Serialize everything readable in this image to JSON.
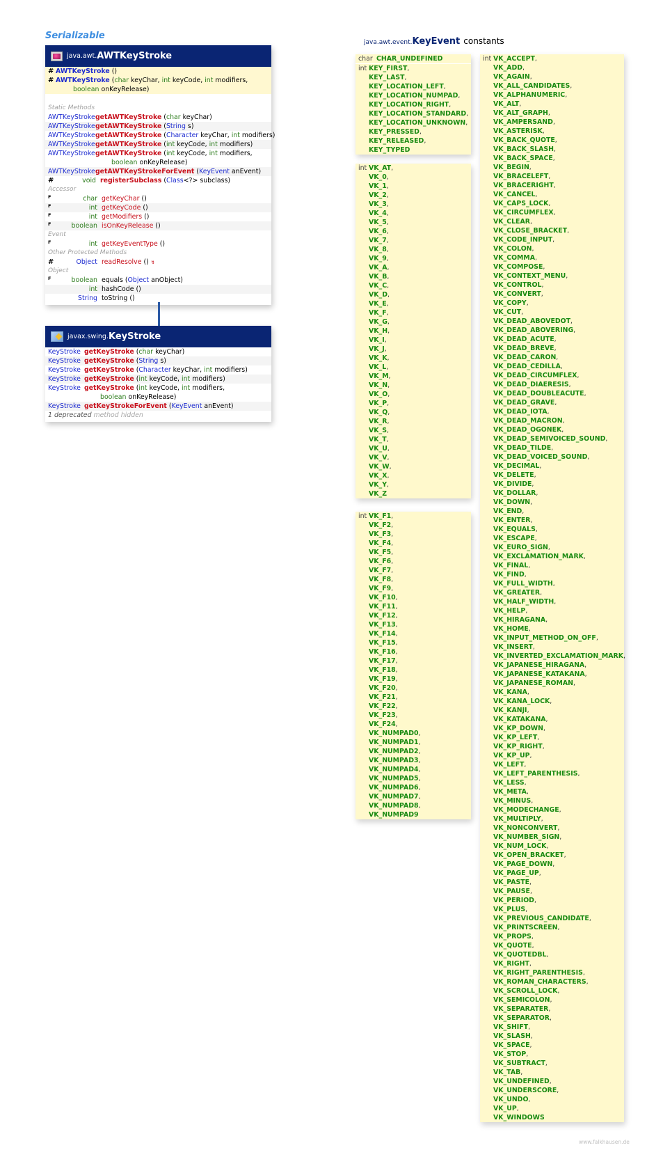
{
  "interface_label": "Serializable",
  "awt_card": {
    "package": "java.awt.",
    "class_name": "AWTKeyStroke",
    "constructors": [
      {
        "modifier": "#",
        "name": "AWTKeyStroke",
        "params": "()"
      },
      {
        "modifier": "#",
        "name": "AWTKeyStroke",
        "params_line1": "(char keyChar, int keyCode, int modifiers,",
        "params_line2": "boolean onKeyRelease)"
      }
    ],
    "sections": {
      "static": "Static Methods",
      "accessor": "Accessor",
      "event": "Event",
      "other_protected": "Other Protected Methods",
      "object": "Object"
    },
    "static_methods": [
      {
        "ret": "AWTKeyStroke",
        "name": "getAWTKeyStroke",
        "params": "(char keyChar)"
      },
      {
        "ret": "AWTKeyStroke",
        "name": "getAWTKeyStroke",
        "params": "(String s)"
      },
      {
        "ret": "AWTKeyStroke",
        "name": "getAWTKeyStroke",
        "params": "(Character keyChar, int modifiers)"
      },
      {
        "ret": "AWTKeyStroke",
        "name": "getAWTKeyStroke",
        "params": "(int keyCode, int modifiers)"
      },
      {
        "ret": "AWTKeyStroke",
        "name": "getAWTKeyStroke",
        "params": "(int keyCode, int modifiers,",
        "params_line2": "boolean onKeyRelease)"
      },
      {
        "ret": "AWTKeyStroke",
        "name": "getAWTKeyStrokeForEvent",
        "params": "(KeyEvent anEvent)"
      },
      {
        "modifier": "#",
        "ret": "void",
        "name": "registerSubclass",
        "params": "(Class<?> subclass)"
      }
    ],
    "accessor_methods": [
      {
        "modifier": "F",
        "ret": "char",
        "name": "getKeyChar",
        "params": "()"
      },
      {
        "modifier": "F",
        "ret": "int",
        "name": "getKeyCode",
        "params": "()"
      },
      {
        "modifier": "F",
        "ret": "int",
        "name": "getModifiers",
        "params": "()"
      },
      {
        "modifier": "F",
        "ret": "boolean",
        "name": "isOnKeyRelease",
        "params": "()"
      }
    ],
    "event_methods": [
      {
        "modifier": "F",
        "ret": "int",
        "name": "getKeyEventType",
        "params": "()"
      }
    ],
    "other_protected_methods": [
      {
        "modifier": "#",
        "ret": "Object",
        "name": "readResolve",
        "params": "()",
        "marker": "↯"
      }
    ],
    "object_methods": [
      {
        "modifier": "F",
        "ret": "boolean",
        "name": "equals",
        "params": "(Object anObject)"
      },
      {
        "ret": "int",
        "name": "hashCode",
        "params": "()"
      },
      {
        "ret": "String",
        "name": "toString",
        "params": "()"
      }
    ]
  },
  "swing_card": {
    "package": "javax.swing.",
    "class_name": "KeyStroke",
    "methods": [
      {
        "ret": "KeyStroke",
        "name": "getKeyStroke",
        "params": "(char keyChar)"
      },
      {
        "ret": "KeyStroke",
        "name": "getKeyStroke",
        "params": "(String s)"
      },
      {
        "ret": "KeyStroke",
        "name": "getKeyStroke",
        "params": "(Character keyChar, int modifiers)"
      },
      {
        "ret": "KeyStroke",
        "name": "getKeyStroke",
        "params": "(int keyCode, int modifiers)"
      },
      {
        "ret": "KeyStroke",
        "name": "getKeyStroke",
        "params": "(int keyCode, int modifiers,",
        "params_line2": "boolean onKeyRelease)"
      },
      {
        "ret": "KeyStroke",
        "name": "getKeyStrokeForEvent",
        "params": "(KeyEvent anEvent)"
      }
    ],
    "hidden_note_bold": "1 deprecated",
    "hidden_note_rest": "method hidden"
  },
  "keyevent": {
    "package": "java.awt.event.",
    "class_name": "KeyEvent",
    "label": "constants",
    "box1": [
      {
        "type": "char",
        "names": [
          "CHAR_UNDEFINED"
        ]
      },
      {
        "type": "int",
        "names": [
          "KEY_FIRST",
          "KEY_LAST",
          "KEY_LOCATION_LEFT",
          "KEY_LOCATION_NUMPAD",
          "KEY_LOCATION_RIGHT",
          "KEY_LOCATION_STANDARD",
          "KEY_LOCATION_UNKNOWN",
          "KEY_PRESSED",
          "KEY_RELEASED",
          "KEY_TYPED"
        ]
      }
    ],
    "box2": {
      "type": "int",
      "names": [
        "VK_AT",
        "VK_0",
        "VK_1",
        "VK_2",
        "VK_3",
        "VK_4",
        "VK_5",
        "VK_6",
        "VK_7",
        "VK_8",
        "VK_9",
        "VK_A",
        "VK_B",
        "VK_C",
        "VK_D",
        "VK_E",
        "VK_F",
        "VK_G",
        "VK_H",
        "VK_I",
        "VK_J",
        "VK_K",
        "VK_L",
        "VK_M",
        "VK_N",
        "VK_O",
        "VK_P",
        "VK_Q",
        "VK_R",
        "VK_S",
        "VK_T",
        "VK_U",
        "VK_V",
        "VK_W",
        "VK_X",
        "VK_Y",
        "VK_Z"
      ]
    },
    "box3": {
      "type": "int",
      "names": [
        "VK_F1",
        "VK_F2",
        "VK_F3",
        "VK_F4",
        "VK_F5",
        "VK_F6",
        "VK_F7",
        "VK_F8",
        "VK_F9",
        "VK_F10",
        "VK_F11",
        "VK_F12",
        "VK_F13",
        "VK_F14",
        "VK_F15",
        "VK_F16",
        "VK_F17",
        "VK_F18",
        "VK_F19",
        "VK_F20",
        "VK_F21",
        "VK_F22",
        "VK_F23",
        "VK_F24",
        "VK_NUMPAD0",
        "VK_NUMPAD1",
        "VK_NUMPAD2",
        "VK_NUMPAD3",
        "VK_NUMPAD4",
        "VK_NUMPAD5",
        "VK_NUMPAD6",
        "VK_NUMPAD7",
        "VK_NUMPAD8",
        "VK_NUMPAD9"
      ]
    },
    "box4": {
      "type": "int",
      "names": [
        "VK_ACCEPT",
        "VK_ADD",
        "VK_AGAIN",
        "VK_ALL_CANDIDATES",
        "VK_ALPHANUMERIC",
        "VK_ALT",
        "VK_ALT_GRAPH",
        "VK_AMPERSAND",
        "VK_ASTERISK",
        "VK_BACK_QUOTE",
        "VK_BACK_SLASH",
        "VK_BACK_SPACE",
        "VK_BEGIN",
        "VK_BRACELEFT",
        "VK_BRACERIGHT",
        "VK_CANCEL",
        "VK_CAPS_LOCK",
        "VK_CIRCUMFLEX",
        "VK_CLEAR",
        "VK_CLOSE_BRACKET",
        "VK_CODE_INPUT",
        "VK_COLON",
        "VK_COMMA",
        "VK_COMPOSE",
        "VK_CONTEXT_MENU",
        "VK_CONTROL",
        "VK_CONVERT",
        "VK_COPY",
        "VK_CUT",
        "VK_DEAD_ABOVEDOT",
        "VK_DEAD_ABOVERING",
        "VK_DEAD_ACUTE",
        "VK_DEAD_BREVE",
        "VK_DEAD_CARON",
        "VK_DEAD_CEDILLA",
        "VK_DEAD_CIRCUMFLEX",
        "VK_DEAD_DIAERESIS",
        "VK_DEAD_DOUBLEACUTE",
        "VK_DEAD_GRAVE",
        "VK_DEAD_IOTA",
        "VK_DEAD_MACRON",
        "VK_DEAD_OGONEK",
        "VK_DEAD_SEMIVOICED_SOUND",
        "VK_DEAD_TILDE",
        "VK_DEAD_VOICED_SOUND",
        "VK_DECIMAL",
        "VK_DELETE",
        "VK_DIVIDE",
        "VK_DOLLAR",
        "VK_DOWN",
        "VK_END",
        "VK_ENTER",
        "VK_EQUALS",
        "VK_ESCAPE",
        "VK_EURO_SIGN",
        "VK_EXCLAMATION_MARK",
        "VK_FINAL",
        "VK_FIND",
        "VK_FULL_WIDTH",
        "VK_GREATER",
        "VK_HALF_WIDTH",
        "VK_HELP",
        "VK_HIRAGANA",
        "VK_HOME",
        "VK_INPUT_METHOD_ON_OFF",
        "VK_INSERT",
        "VK_INVERTED_EXCLAMATION_MARK",
        "VK_JAPANESE_HIRAGANA",
        "VK_JAPANESE_KATAKANA",
        "VK_JAPANESE_ROMAN",
        "VK_KANA",
        "VK_KANA_LOCK",
        "VK_KANJI",
        "VK_KATAKANA",
        "VK_KP_DOWN",
        "VK_KP_LEFT",
        "VK_KP_RIGHT",
        "VK_KP_UP",
        "VK_LEFT",
        "VK_LEFT_PARENTHESIS",
        "VK_LESS",
        "VK_META",
        "VK_MINUS",
        "VK_MODECHANGE",
        "VK_MULTIPLY",
        "VK_NONCONVERT",
        "VK_NUMBER_SIGN",
        "VK_NUM_LOCK",
        "VK_OPEN_BRACKET",
        "VK_PAGE_DOWN",
        "VK_PAGE_UP",
        "VK_PASTE",
        "VK_PAUSE",
        "VK_PERIOD",
        "VK_PLUS",
        "VK_PREVIOUS_CANDIDATE",
        "VK_PRINTSCREEN",
        "VK_PROPS",
        "VK_QUOTE",
        "VK_QUOTEDBL",
        "VK_RIGHT",
        "VK_RIGHT_PARENTHESIS",
        "VK_ROMAN_CHARACTERS",
        "VK_SCROLL_LOCK",
        "VK_SEMICOLON",
        "VK_SEPARATER",
        "VK_SEPARATOR",
        "VK_SHIFT",
        "VK_SLASH",
        "VK_SPACE",
        "VK_STOP",
        "VK_SUBTRACT",
        "VK_TAB",
        "VK_UNDEFINED",
        "VK_UNDERSCORE",
        "VK_UNDO",
        "VK_UP",
        "VK_WINDOWS"
      ]
    }
  },
  "footer": "www.falkhausen.de",
  "colors": {
    "header_bg": "#0a2573",
    "type_blue": "#1d2bd0",
    "primitive_green": "#2e7d1e",
    "method_red": "#c8101c",
    "constant_green": "#1a8a12",
    "constant_bg": "#fff9cc",
    "ctor_bg": "#fff8d0",
    "connector": "#2c5aa6",
    "interface_label": "#3e8ee0"
  }
}
